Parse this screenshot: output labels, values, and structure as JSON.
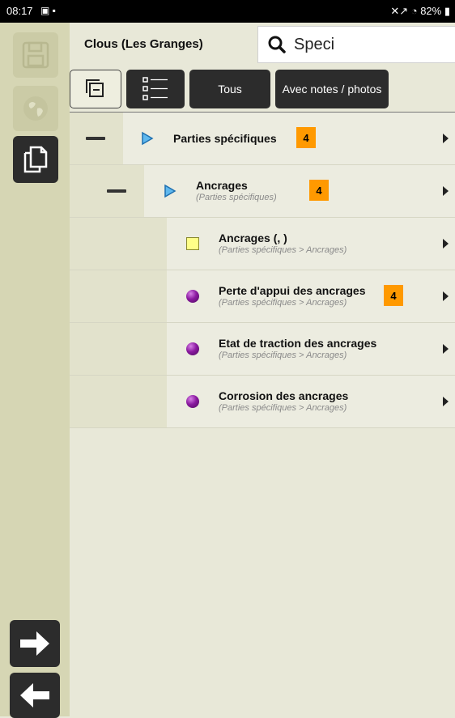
{
  "status": {
    "time": "08:17",
    "left_icons": "▣ ▪",
    "right": "✕↗ ◔ 82% ▮"
  },
  "header": {
    "title": "Clous (Les Granges)",
    "search_value": "Speci"
  },
  "toolbar": {
    "tous_label": "Tous",
    "notes_label": "Avec notes / photos"
  },
  "tree": [
    {
      "title": "Parties spécifiques",
      "path": "",
      "badge": "4"
    },
    {
      "title": "Ancrages",
      "path": "(Parties spécifiques)",
      "badge": "4"
    },
    {
      "title": "Ancrages (, )",
      "path": "(Parties spécifiques > Ancrages)",
      "badge": ""
    },
    {
      "title": "Perte d'appui des ancrages",
      "path": "(Parties spécifiques > Ancrages)",
      "badge": "4"
    },
    {
      "title": "Etat de traction des ancrages",
      "path": "(Parties spécifiques > Ancrages)",
      "badge": ""
    },
    {
      "title": "Corrosion des ancrages",
      "path": "(Parties spécifiques > Ancrages)",
      "badge": ""
    }
  ],
  "colors": {
    "badge": "#ff9900",
    "dark_button": "#2c2c2c",
    "rail": "#d6d6b4",
    "background": "#e8e8d8"
  },
  "icons": {
    "rail": [
      "save-icon",
      "globe-icon",
      "copy-icon",
      "arrow-right-icon",
      "arrow-left-icon"
    ],
    "toolbar": [
      "collapse-all-icon",
      "list-icon"
    ],
    "search": "search-icon"
  }
}
